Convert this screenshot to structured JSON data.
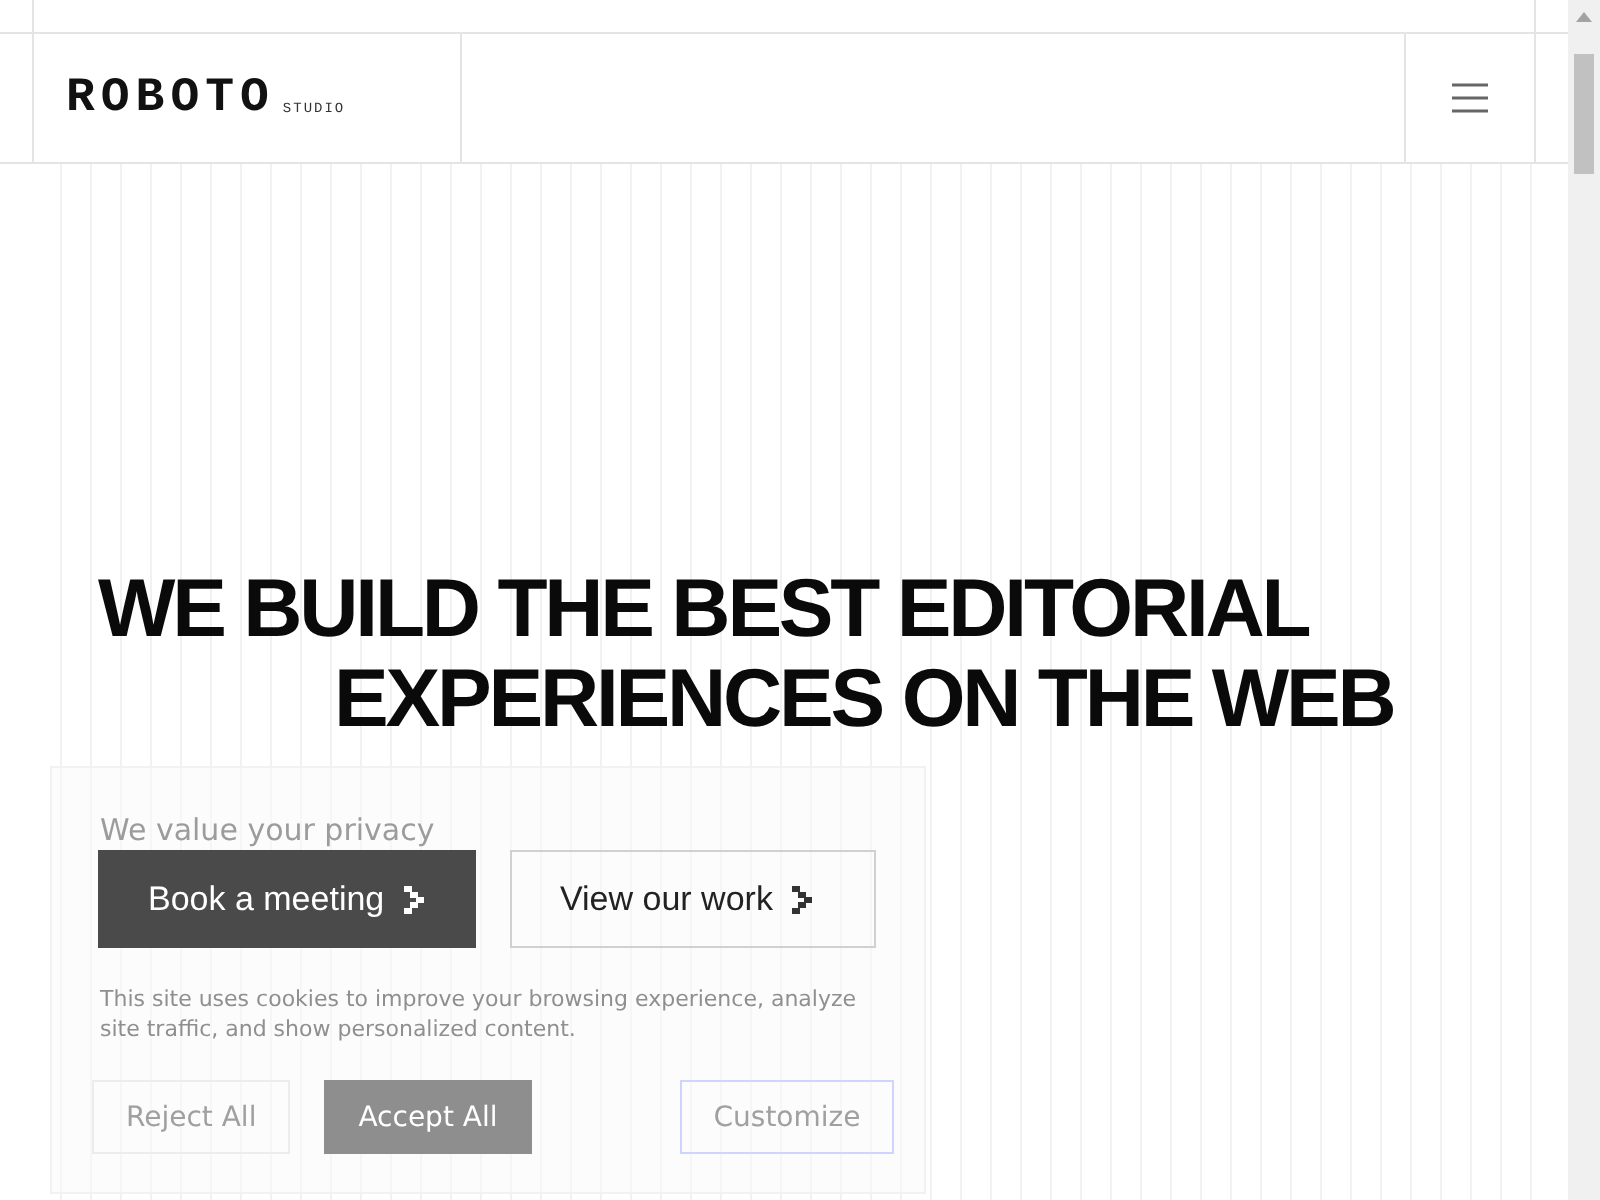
{
  "header": {
    "logo": "ROBOTO",
    "logo_subtitle": "STUDIO"
  },
  "hero": {
    "headline": [
      "WE BUILD THE BEST EDITORIAL",
      "EXPERIENCES ON THE WEB"
    ],
    "buttons": [
      {
        "label": "Book a meeting",
        "kind": "primary"
      },
      {
        "label": "View our work",
        "kind": "secondary"
      }
    ]
  },
  "cookie_banner": {
    "title": "We value your privacy",
    "text": "This site uses cookies to improve your browsing experience, analyze site traffic, and show personalized content.",
    "buttons": [
      {
        "label": "Reject All",
        "kind": "outline"
      },
      {
        "label": "Accept All",
        "kind": "filled"
      },
      {
        "label": "Customize",
        "kind": "accent"
      }
    ]
  }
}
